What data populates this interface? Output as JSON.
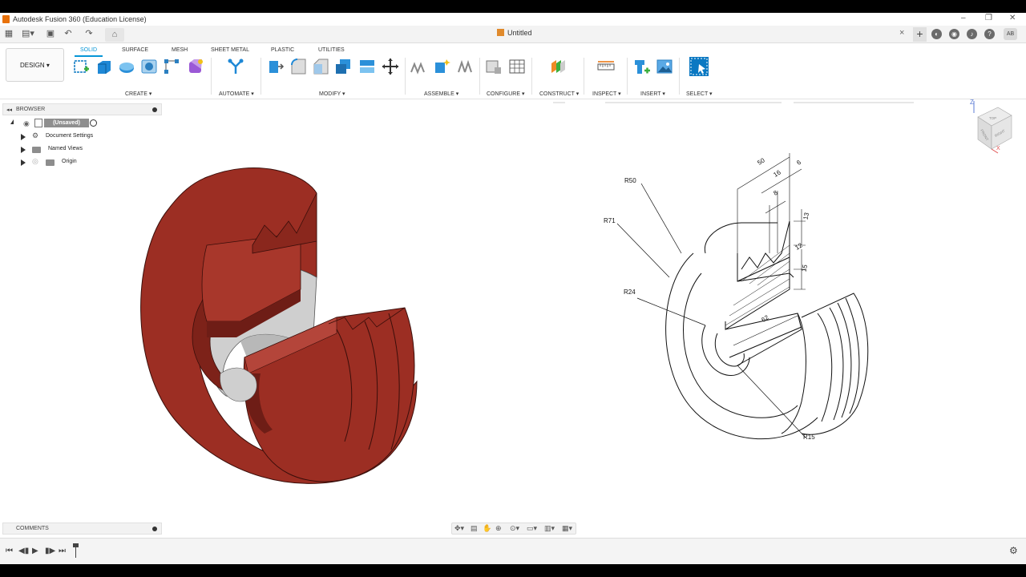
{
  "window": {
    "title": "Autodesk Fusion 360 (Education License)",
    "document_title": "Untitled",
    "user_initials": "AB"
  },
  "toolbar": {
    "workspace": "DESIGN",
    "tabs": [
      "SOLID",
      "SURFACE",
      "MESH",
      "SHEET METAL",
      "PLASTIC",
      "UTILITIES"
    ],
    "active_tab": "SOLID",
    "groups": [
      "CREATE",
      "AUTOMATE",
      "MODIFY",
      "ASSEMBLE",
      "CONFIGURE",
      "CONSTRUCT",
      "INSPECT",
      "INSERT",
      "SELECT"
    ]
  },
  "browser": {
    "header": "BROWSER",
    "root": "(Unsaved)",
    "items": [
      "Document Settings",
      "Named Views",
      "Origin"
    ]
  },
  "comments": {
    "label": "COMMENTS"
  },
  "drawing": {
    "dimensions": {
      "r50": "R50",
      "r71": "R71",
      "r24": "R24",
      "r15": "R15",
      "d50": "50",
      "d16": "16",
      "d6": "6",
      "d8": "8",
      "d13": "13",
      "d12": "12",
      "d15": "15",
      "d62": "62"
    }
  },
  "viewcube": {
    "top": "TOP",
    "front": "FRONT",
    "right": "RIGHT",
    "z": "Z",
    "x": "X"
  },
  "colors": {
    "accent": "#0696d7",
    "model": "#9c2e23",
    "model_dark": "#6e1d16",
    "inner": "#cfcfcf"
  }
}
